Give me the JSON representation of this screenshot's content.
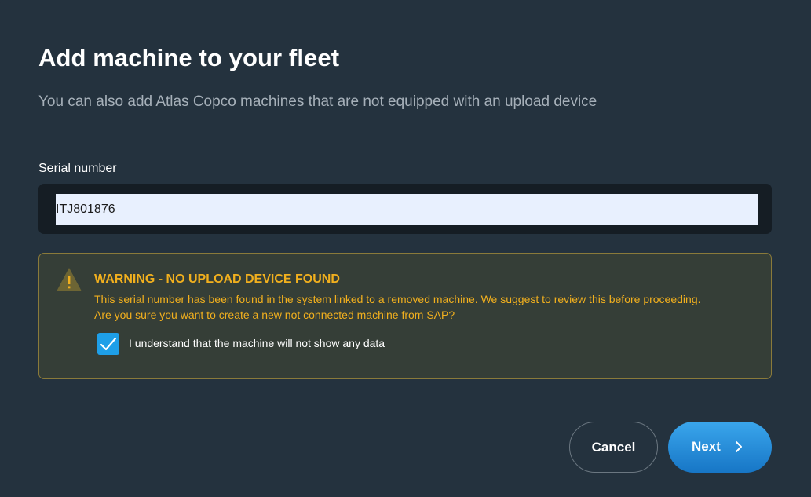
{
  "dialog": {
    "title": "Add machine to your fleet",
    "subtitle": "You can also add Atlas Copco machines that are not equipped with an upload device"
  },
  "serial_field": {
    "label": "Serial number",
    "value": "ITJ801876"
  },
  "warning": {
    "icon": "warning-triangle-icon",
    "title": "WARNING - NO UPLOAD DEVICE FOUND",
    "line1": "This serial number has been found in the system linked to a removed machine. We suggest to review this before proceeding.",
    "line2": "Are you sure you want to create a new not connected machine from SAP?",
    "checkbox_checked": true,
    "checkbox_label": "I understand that the machine will not show any data"
  },
  "actions": {
    "cancel_label": "Cancel",
    "next_label": "Next",
    "next_icon": "chevron-right-icon"
  },
  "colors": {
    "background": "#24323e",
    "warning_text": "#f2b01e",
    "accent": "#1e9fe8"
  }
}
